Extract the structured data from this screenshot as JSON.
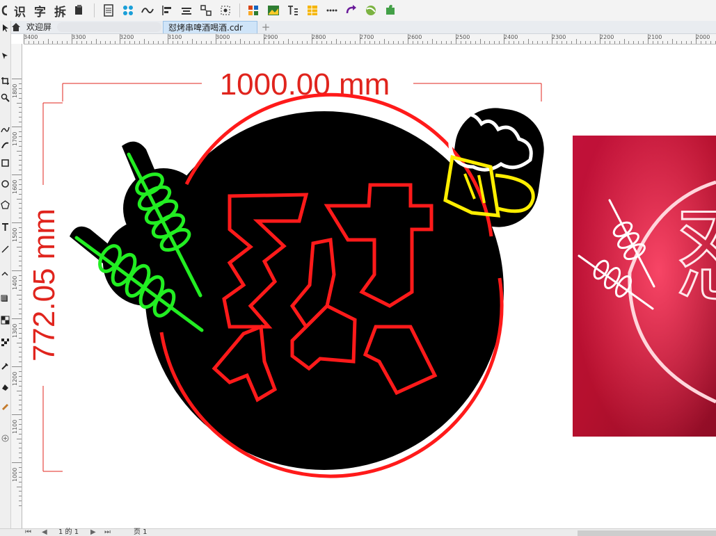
{
  "toolbar": {
    "items": [
      {
        "kind": "text",
        "label": "识",
        "name": "text-tool-button"
      },
      {
        "kind": "text",
        "label": "字",
        "name": "font-tool-button"
      },
      {
        "kind": "text",
        "label": "拆",
        "name": "split-tool-button"
      },
      {
        "kind": "icon",
        "icon": "clipboard-icon"
      },
      {
        "kind": "sep"
      },
      {
        "kind": "icon",
        "icon": "document-icon"
      },
      {
        "kind": "icon",
        "icon": "node-grid-icon"
      },
      {
        "kind": "icon",
        "icon": "wave-curve-icon"
      },
      {
        "kind": "icon",
        "icon": "align-left-icon"
      },
      {
        "kind": "icon",
        "icon": "align-center-icon"
      },
      {
        "kind": "icon",
        "icon": "transform-icon"
      },
      {
        "kind": "icon",
        "icon": "selection-box-icon"
      },
      {
        "kind": "sep"
      },
      {
        "kind": "icon",
        "icon": "color-palette-icon"
      },
      {
        "kind": "icon",
        "icon": "image-frame-icon"
      },
      {
        "kind": "icon",
        "icon": "text-columns-icon"
      },
      {
        "kind": "icon",
        "icon": "grid-yellow-icon"
      },
      {
        "kind": "icon",
        "icon": "dots-row-icon"
      },
      {
        "kind": "icon",
        "icon": "redo-arrow-icon"
      },
      {
        "kind": "icon",
        "icon": "ball-icon"
      },
      {
        "kind": "icon",
        "icon": "puzzle-icon"
      }
    ]
  },
  "tabs": {
    "welcome": "欢迎屏",
    "document": "怼烤串啤酒喝酒.cdr",
    "add": "+"
  },
  "ruler_top": {
    "labels": [
      "3400",
      "3300",
      "3200",
      "3100",
      "3000",
      "2900",
      "2800",
      "2700",
      "2600",
      "2500",
      "2400",
      "2300",
      "2200",
      "2100",
      "2000"
    ]
  },
  "ruler_left": {
    "labels": [
      "1800",
      "1700",
      "1600",
      "1500",
      "1400",
      "1300",
      "1200",
      "1100",
      "1000"
    ]
  },
  "dimensions": {
    "width_label": "1000.00 mm",
    "height_label": "772.05 mm"
  },
  "artwork": {
    "character": "怼",
    "colors": {
      "neon_red": "#ff1a1a",
      "neon_green": "#22ee22",
      "neon_yellow": "#ffee00",
      "background_black": "#000000",
      "dimension_red": "#e0241d"
    }
  },
  "preview": {
    "character": "怼"
  },
  "statusbar": {
    "pager": "1 的 1",
    "page_tab": "页 1"
  }
}
